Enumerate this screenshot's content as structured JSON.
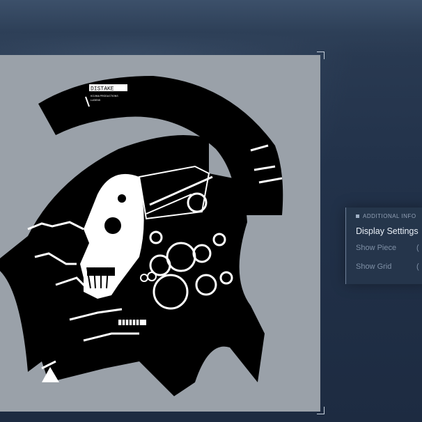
{
  "panel": {
    "header": "ADDITIONAL INFO",
    "title": "Display Settings",
    "options": [
      {
        "label": "Show Piece",
        "toggle": "("
      },
      {
        "label": "Show Grid",
        "toggle": "("
      }
    ]
  },
  "artwork": {
    "badge_text": "DISTAKE",
    "badge_subtext_1": "KOJIMA PRODUCTIONS",
    "badge_subtext_2": "LUDENS"
  },
  "colors": {
    "background": "#22324a",
    "canvas": "#9aa1a9",
    "panel": "#26364c",
    "art_fill": "#000000",
    "art_light": "#ffffff"
  }
}
